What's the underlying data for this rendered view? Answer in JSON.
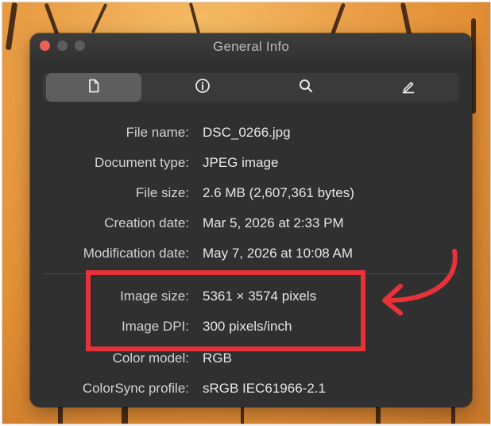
{
  "window": {
    "title": "General Info"
  },
  "toolbar": {
    "tabs": [
      {
        "icon": "document-icon",
        "active": true
      },
      {
        "icon": "info-icon",
        "active": false
      },
      {
        "icon": "search-icon",
        "active": false
      },
      {
        "icon": "pencil-icon",
        "active": false
      }
    ]
  },
  "info": {
    "file_name": {
      "label": "File name:",
      "value": "DSC_0266.jpg"
    },
    "document_type": {
      "label": "Document type:",
      "value": "JPEG image"
    },
    "file_size": {
      "label": "File size:",
      "value": "2.6 MB (2,607,361 bytes)"
    },
    "creation_date": {
      "label": "Creation date:",
      "value": "Mar 5, 2026 at 2:33 PM"
    },
    "modification_date": {
      "label": "Modification date:",
      "value": "May 7, 2026 at 10:08 AM"
    },
    "image_size": {
      "label": "Image size:",
      "value": "5361 × 3574 pixels"
    },
    "image_dpi": {
      "label": "Image DPI:",
      "value": "300 pixels/inch"
    },
    "color_model": {
      "label": "Color model:",
      "value": "RGB"
    },
    "colorsync_profile": {
      "label": "ColorSync profile:",
      "value": "sRGB IEC61966-2.1"
    }
  },
  "annotation": {
    "highlight_color": "#e8323a",
    "arrow_color": "#e8323a"
  }
}
